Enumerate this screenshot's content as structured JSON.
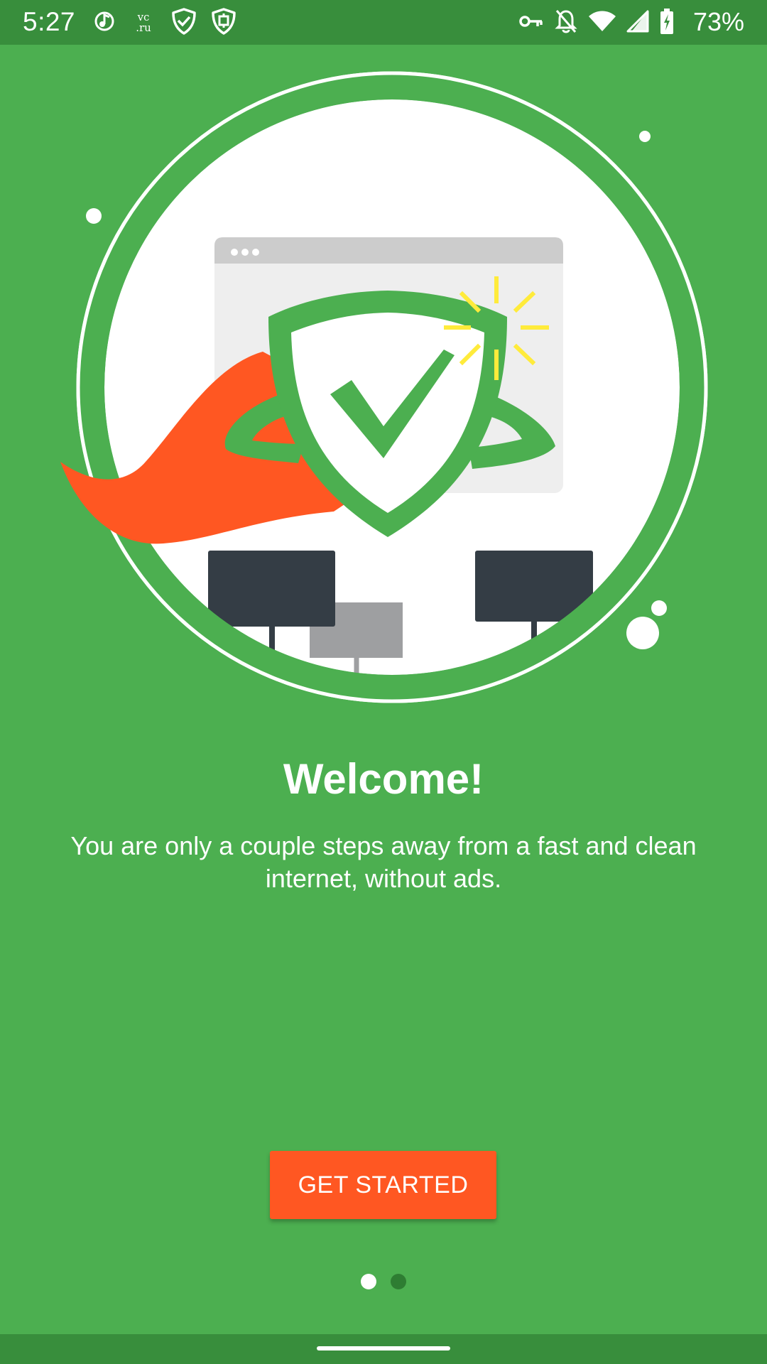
{
  "status_bar": {
    "time": "5:27",
    "battery": "73%",
    "left_icons": [
      "music-notification-icon",
      "vc-ru-icon",
      "shield-check-icon",
      "shield-app-icon"
    ],
    "vc_icon_text_top": "vc",
    "vc_icon_text_bottom": ".ru",
    "right_icons": [
      "vpn-key-icon",
      "notifications-off-icon",
      "wifi-icon",
      "cell-signal-icon",
      "battery-charging-icon"
    ]
  },
  "onboarding": {
    "title": "Welcome!",
    "subtitle": "You are only a couple steps away from a fast and clean internet, without ads.",
    "primary_button": "GET STARTED",
    "pages_total": 2,
    "current_page": 1
  },
  "colors": {
    "background": "#4caf50",
    "status_bar": "#388e3c",
    "accent": "#ff5722",
    "dot_active": "#ffffff",
    "dot_inactive": "#2e7d32"
  }
}
